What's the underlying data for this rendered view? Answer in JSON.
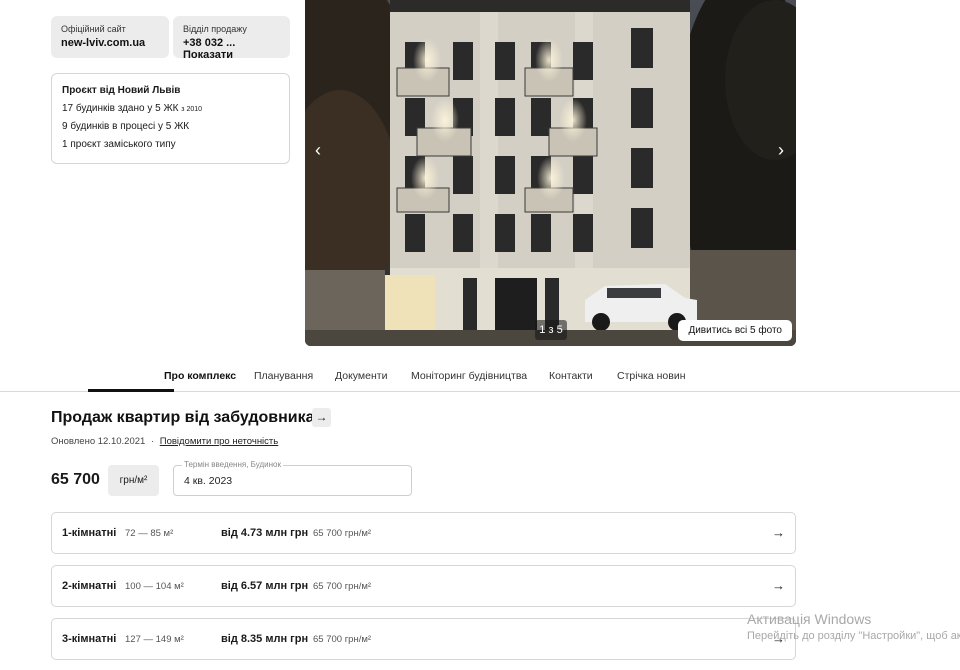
{
  "contacts": {
    "site_label": "Офіційний сайт",
    "site_value": "new-lviv.com.ua",
    "sales_label": "Відділ продажу",
    "sales_value": "+38 032 ... Показати"
  },
  "project": {
    "title": "Проєкт від Новий Львів",
    "line1": "17 будинків здано у 5 ЖК",
    "line1_small": "з 2010",
    "line2": "9 будинків в процесі у 5 ЖК",
    "line3": "1 проєкт заміського типу"
  },
  "gallery": {
    "prev_icon": "‹",
    "next_icon": "›",
    "counter": "1 з 5",
    "all_photos": "Дивитись всі 5 фото"
  },
  "tabs": [
    {
      "label": "Про комплекс",
      "active": true
    },
    {
      "label": "Планування"
    },
    {
      "label": "Документи"
    },
    {
      "label": "Моніторинг будівництва"
    },
    {
      "label": "Контакти"
    },
    {
      "label": "Стрічка новин"
    }
  ],
  "sales": {
    "title": "Продаж квартир від забудовника",
    "arrow": "→",
    "updated": "Оновлено 12.10.2021",
    "separator": "·",
    "report_link": "Повідомити про неточність",
    "price": "65 700",
    "unit": "грн/м²",
    "field_label": "Термін введення, Будинок",
    "field_value": "4 кв. 2023"
  },
  "apartments": [
    {
      "rooms": "1-кімнатні",
      "area": "72 — 85 м²",
      "from": "від 4.73 млн грн",
      "ppm": "65 700 грн/м²",
      "arrow": "→"
    },
    {
      "rooms": "2-кімнатні",
      "area": "100 — 104 м²",
      "from": "від 6.57 млн грн",
      "ppm": "65 700 грн/м²",
      "arrow": "→"
    },
    {
      "rooms": "3-кімнатні",
      "area": "127 — 149 м²",
      "from": "від 8.35 млн грн",
      "ppm": "65 700 грн/м²",
      "arrow": "→"
    }
  ],
  "watermark": {
    "line1": "Активація Windows",
    "line2": "Перейдіть до розділу \"Настройки\", щоб акти"
  }
}
